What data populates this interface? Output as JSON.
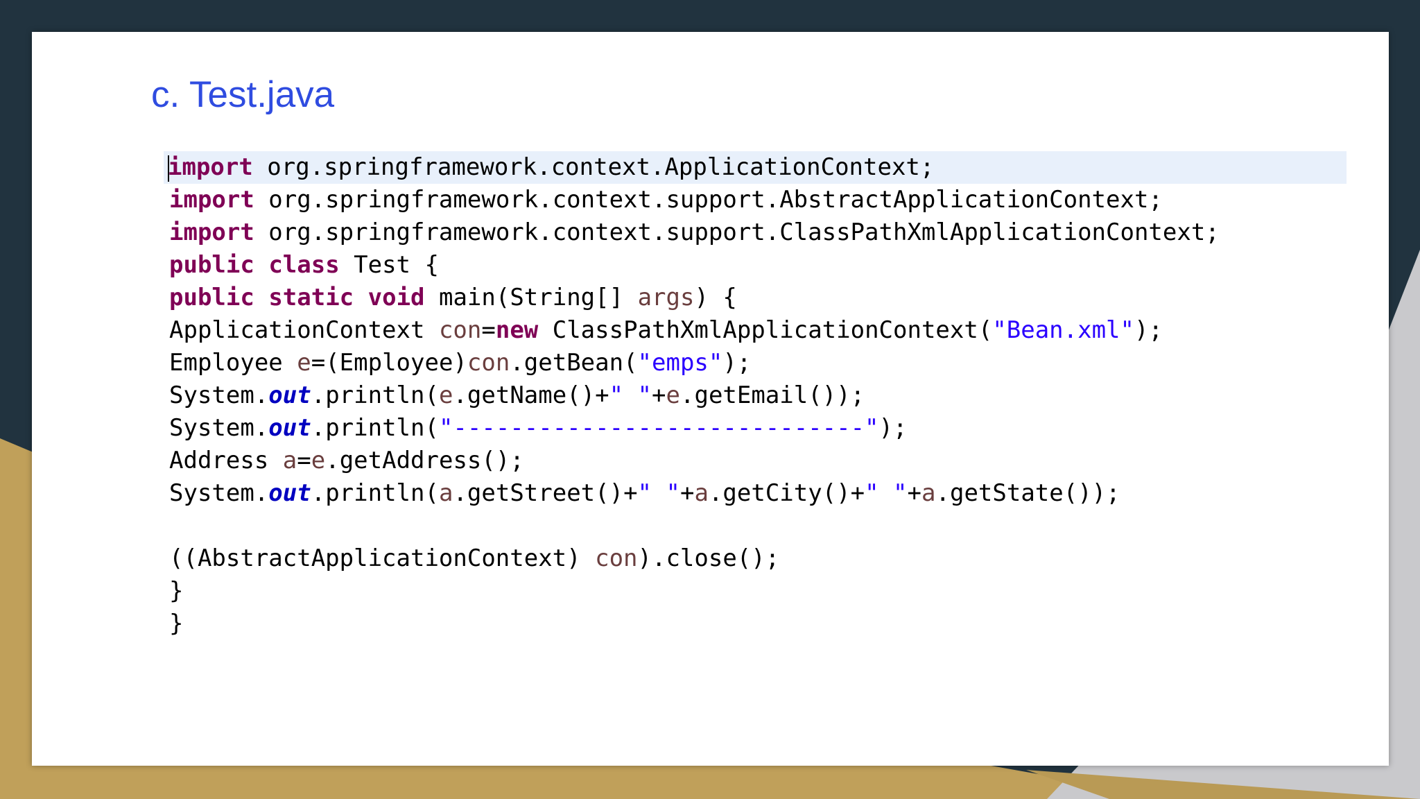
{
  "slide": {
    "title": "c. Test.java"
  },
  "code": {
    "lines": [
      [
        {
          "t": "import",
          "c": "kw"
        },
        {
          "t": " org.springframework.context.ApplicationContext;"
        }
      ],
      [
        {
          "t": "import",
          "c": "kw"
        },
        {
          "t": " org.springframework.context.support.AbstractApplicationContext;"
        }
      ],
      [
        {
          "t": "import",
          "c": "kw"
        },
        {
          "t": " org.springframework.context.support.ClassPathXmlApplicationContext;"
        }
      ],
      [
        {
          "t": "public",
          "c": "kw"
        },
        {
          "t": " "
        },
        {
          "t": "class",
          "c": "kw"
        },
        {
          "t": " Test {"
        }
      ],
      [
        {
          "t": "public",
          "c": "kw"
        },
        {
          "t": " "
        },
        {
          "t": "static",
          "c": "kw"
        },
        {
          "t": " "
        },
        {
          "t": "void",
          "c": "kw"
        },
        {
          "t": " main(String[] "
        },
        {
          "t": "args",
          "c": "var"
        },
        {
          "t": ") {"
        }
      ],
      [
        {
          "t": "ApplicationContext "
        },
        {
          "t": "con",
          "c": "var"
        },
        {
          "t": "="
        },
        {
          "t": "new",
          "c": "kw"
        },
        {
          "t": " ClassPathXmlApplicationContext("
        },
        {
          "t": "\"Bean.xml\"",
          "c": "str"
        },
        {
          "t": ");"
        }
      ],
      [
        {
          "t": "Employee "
        },
        {
          "t": "e",
          "c": "var"
        },
        {
          "t": "=(Employee)"
        },
        {
          "t": "con",
          "c": "var"
        },
        {
          "t": ".getBean("
        },
        {
          "t": "\"emps\"",
          "c": "str"
        },
        {
          "t": ");"
        }
      ],
      [
        {
          "t": "System."
        },
        {
          "t": "out",
          "c": "fld"
        },
        {
          "t": ".println("
        },
        {
          "t": "e",
          "c": "var"
        },
        {
          "t": ".getName()+"
        },
        {
          "t": "\" \"",
          "c": "str"
        },
        {
          "t": "+"
        },
        {
          "t": "e",
          "c": "var"
        },
        {
          "t": ".getEmail());"
        }
      ],
      [
        {
          "t": "System."
        },
        {
          "t": "out",
          "c": "fld"
        },
        {
          "t": ".println("
        },
        {
          "t": "\"-----------------------------\"",
          "c": "str"
        },
        {
          "t": ");"
        }
      ],
      [
        {
          "t": "Address "
        },
        {
          "t": "a",
          "c": "var"
        },
        {
          "t": "="
        },
        {
          "t": "e",
          "c": "var"
        },
        {
          "t": ".getAddress();"
        }
      ],
      [
        {
          "t": "System."
        },
        {
          "t": "out",
          "c": "fld"
        },
        {
          "t": ".println("
        },
        {
          "t": "a",
          "c": "var"
        },
        {
          "t": ".getStreet()+"
        },
        {
          "t": "\" \"",
          "c": "str"
        },
        {
          "t": "+"
        },
        {
          "t": "a",
          "c": "var"
        },
        {
          "t": ".getCity()+"
        },
        {
          "t": "\" \"",
          "c": "str"
        },
        {
          "t": "+"
        },
        {
          "t": "a",
          "c": "var"
        },
        {
          "t": ".getState());"
        }
      ],
      [],
      [
        {
          "t": "((AbstractApplicationContext) "
        },
        {
          "t": "con",
          "c": "var"
        },
        {
          "t": ").close();"
        }
      ],
      [
        {
          "t": "}"
        }
      ],
      [
        {
          "t": "}"
        }
      ]
    ]
  },
  "colors": {
    "background_dark": "#21333f",
    "background_gold": "#c0a05a",
    "background_gray": "#c9c9cc",
    "title": "#2f4ce0",
    "keyword": "#7f0055",
    "string": "#2a00ff",
    "field": "#0000c0",
    "variable": "#6a3e3e",
    "current_line": "#e8f0fb"
  }
}
